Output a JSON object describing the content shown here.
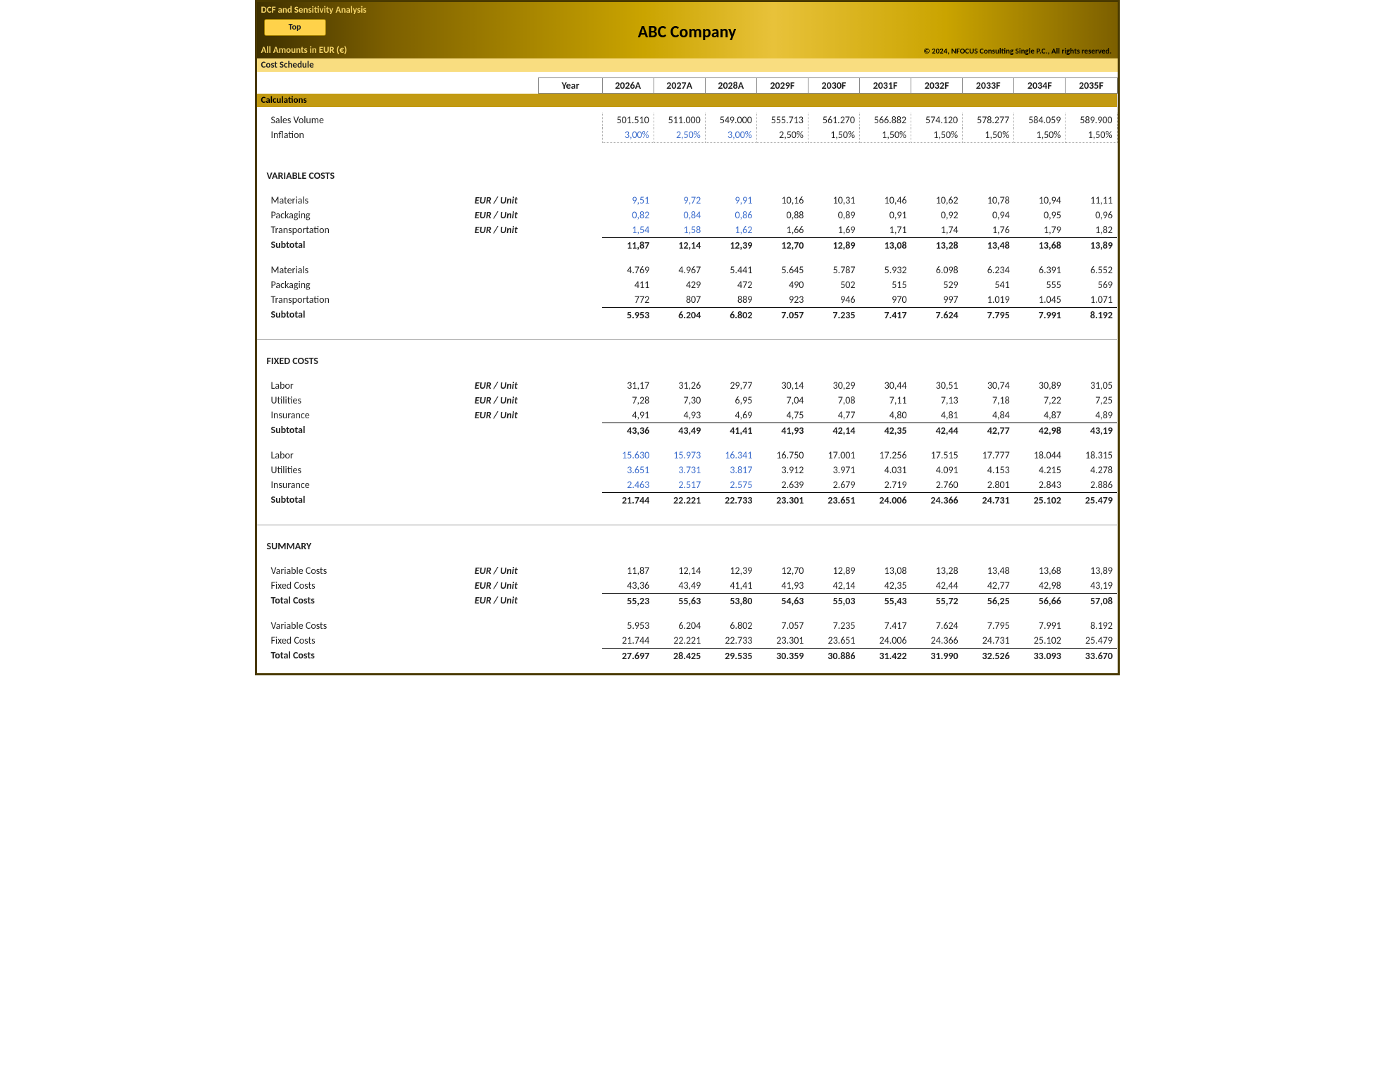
{
  "header": {
    "title": "DCF and Sensitivity Analysis",
    "top_btn": "Top",
    "company": "ABC Company",
    "amounts": "All Amounts in  EUR (€)",
    "copyright": "© 2024, NFOCUS Consulting Single P.C., All rights reserved."
  },
  "bands": {
    "cost_schedule": "Cost Schedule",
    "calculations": "Calculations"
  },
  "year_label": "Year",
  "years": [
    "2026A",
    "2027A",
    "2028A",
    "2029F",
    "2030F",
    "2031F",
    "2032F",
    "2033F",
    "2034F",
    "2035F"
  ],
  "rows": {
    "sales_volume": {
      "label": "Sales Volume",
      "vals": [
        "501.510",
        "511.000",
        "549.000",
        "555.713",
        "561.270",
        "566.882",
        "574.120",
        "578.277",
        "584.059",
        "589.900"
      ]
    },
    "inflation": {
      "label": "Inflation",
      "vals": [
        "3,00%",
        "2,50%",
        "3,00%",
        "2,50%",
        "1,50%",
        "1,50%",
        "1,50%",
        "1,50%",
        "1,50%",
        "1,50%"
      ],
      "blue_to": 3
    }
  },
  "sections": {
    "variable": {
      "title": "VARIABLE COSTS",
      "unit_rows": [
        {
          "label": "Materials",
          "unit": "EUR / Unit",
          "vals": [
            "9,51",
            "9,72",
            "9,91",
            "10,16",
            "10,31",
            "10,46",
            "10,62",
            "10,78",
            "10,94",
            "11,11"
          ],
          "blue_to": 3
        },
        {
          "label": "Packaging",
          "unit": "EUR / Unit",
          "vals": [
            "0,82",
            "0,84",
            "0,86",
            "0,88",
            "0,89",
            "0,91",
            "0,92",
            "0,94",
            "0,95",
            "0,96"
          ],
          "blue_to": 3
        },
        {
          "label": "Transportation",
          "unit": "EUR / Unit",
          "vals": [
            "1,54",
            "1,58",
            "1,62",
            "1,66",
            "1,69",
            "1,71",
            "1,74",
            "1,76",
            "1,79",
            "1,82"
          ],
          "blue_to": 3
        }
      ],
      "unit_sub": {
        "label": "Subtotal",
        "vals": [
          "11,87",
          "12,14",
          "12,39",
          "12,70",
          "12,89",
          "13,08",
          "13,28",
          "13,48",
          "13,68",
          "13,89"
        ]
      },
      "abs_rows": [
        {
          "label": "Materials",
          "vals": [
            "4.769",
            "4.967",
            "5.441",
            "5.645",
            "5.787",
            "5.932",
            "6.098",
            "6.234",
            "6.391",
            "6.552"
          ]
        },
        {
          "label": "Packaging",
          "vals": [
            "411",
            "429",
            "472",
            "490",
            "502",
            "515",
            "529",
            "541",
            "555",
            "569"
          ]
        },
        {
          "label": "Transportation",
          "vals": [
            "772",
            "807",
            "889",
            "923",
            "946",
            "970",
            "997",
            "1.019",
            "1.045",
            "1.071"
          ]
        }
      ],
      "abs_sub": {
        "label": "Subtotal",
        "vals": [
          "5.953",
          "6.204",
          "6.802",
          "7.057",
          "7.235",
          "7.417",
          "7.624",
          "7.795",
          "7.991",
          "8.192"
        ]
      }
    },
    "fixed": {
      "title": "FIXED COSTS",
      "unit_rows": [
        {
          "label": "Labor",
          "unit": "EUR / Unit",
          "vals": [
            "31,17",
            "31,26",
            "29,77",
            "30,14",
            "30,29",
            "30,44",
            "30,51",
            "30,74",
            "30,89",
            "31,05"
          ]
        },
        {
          "label": "Utilities",
          "unit": "EUR / Unit",
          "vals": [
            "7,28",
            "7,30",
            "6,95",
            "7,04",
            "7,08",
            "7,11",
            "7,13",
            "7,18",
            "7,22",
            "7,25"
          ]
        },
        {
          "label": "Insurance",
          "unit": "EUR / Unit",
          "vals": [
            "4,91",
            "4,93",
            "4,69",
            "4,75",
            "4,77",
            "4,80",
            "4,81",
            "4,84",
            "4,87",
            "4,89"
          ]
        }
      ],
      "unit_sub": {
        "label": "Subtotal",
        "vals": [
          "43,36",
          "43,49",
          "41,41",
          "41,93",
          "42,14",
          "42,35",
          "42,44",
          "42,77",
          "42,98",
          "43,19"
        ]
      },
      "abs_rows": [
        {
          "label": "Labor",
          "vals": [
            "15.630",
            "15.973",
            "16.341",
            "16.750",
            "17.001",
            "17.256",
            "17.515",
            "17.777",
            "18.044",
            "18.315"
          ],
          "blue_to": 3
        },
        {
          "label": "Utilities",
          "vals": [
            "3.651",
            "3.731",
            "3.817",
            "3.912",
            "3.971",
            "4.031",
            "4.091",
            "4.153",
            "4.215",
            "4.278"
          ],
          "blue_to": 3
        },
        {
          "label": "Insurance",
          "vals": [
            "2.463",
            "2.517",
            "2.575",
            "2.639",
            "2.679",
            "2.719",
            "2.760",
            "2.801",
            "2.843",
            "2.886"
          ],
          "blue_to": 3
        }
      ],
      "abs_sub": {
        "label": "Subtotal",
        "vals": [
          "21.744",
          "22.221",
          "22.733",
          "23.301",
          "23.651",
          "24.006",
          "24.366",
          "24.731",
          "25.102",
          "25.479"
        ]
      }
    },
    "summary": {
      "title": "SUMMARY",
      "unit_rows": [
        {
          "label": "Variable Costs",
          "unit": "EUR / Unit",
          "vals": [
            "11,87",
            "12,14",
            "12,39",
            "12,70",
            "12,89",
            "13,08",
            "13,28",
            "13,48",
            "13,68",
            "13,89"
          ]
        },
        {
          "label": "Fixed Costs",
          "unit": "EUR / Unit",
          "vals": [
            "43,36",
            "43,49",
            "41,41",
            "41,93",
            "42,14",
            "42,35",
            "42,44",
            "42,77",
            "42,98",
            "43,19"
          ]
        }
      ],
      "unit_total": {
        "label": "Total Costs",
        "unit": "EUR / Unit",
        "vals": [
          "55,23",
          "55,63",
          "53,80",
          "54,63",
          "55,03",
          "55,43",
          "55,72",
          "56,25",
          "56,66",
          "57,08"
        ]
      },
      "abs_rows": [
        {
          "label": "Variable Costs",
          "vals": [
            "5.953",
            "6.204",
            "6.802",
            "7.057",
            "7.235",
            "7.417",
            "7.624",
            "7.795",
            "7.991",
            "8.192"
          ]
        },
        {
          "label": "Fixed Costs",
          "vals": [
            "21.744",
            "22.221",
            "22.733",
            "23.301",
            "23.651",
            "24.006",
            "24.366",
            "24.731",
            "25.102",
            "25.479"
          ]
        }
      ],
      "abs_total": {
        "label": "Total Costs",
        "vals": [
          "27.697",
          "28.425",
          "29.535",
          "30.359",
          "30.886",
          "31.422",
          "31.990",
          "32.526",
          "33.093",
          "33.670"
        ]
      }
    }
  },
  "chart_data": {
    "type": "table",
    "years": [
      "2026A",
      "2027A",
      "2028A",
      "2029F",
      "2030F",
      "2031F",
      "2032F",
      "2033F",
      "2034F",
      "2035F"
    ],
    "total_costs_per_unit": [
      55.23,
      55.63,
      53.8,
      54.63,
      55.03,
      55.43,
      55.72,
      56.25,
      56.66,
      57.08
    ],
    "total_costs_abs": [
      27697,
      28425,
      29535,
      30359,
      30886,
      31422,
      31990,
      32526,
      33093,
      33670
    ]
  }
}
